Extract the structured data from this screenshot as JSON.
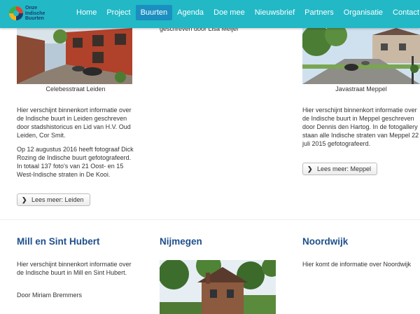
{
  "brand": {
    "logo_lines": [
      "Onze",
      "Indische",
      "Buurten"
    ]
  },
  "nav": {
    "items": [
      {
        "label": "Home",
        "active": false
      },
      {
        "label": "Project",
        "active": false
      },
      {
        "label": "Buurten",
        "active": true
      },
      {
        "label": "Agenda",
        "active": false
      },
      {
        "label": "Doe mee",
        "active": false
      },
      {
        "label": "Nieuwsbrief",
        "active": false
      },
      {
        "label": "Partners",
        "active": false
      },
      {
        "label": "Organisatie",
        "active": false
      },
      {
        "label": "Contact",
        "active": false
      }
    ]
  },
  "leiden": {
    "caption": "Celebesstraat Leiden",
    "para1": "Hier verschijnt binnenkort informatie over de Indische buurt in Leiden geschreven door stadshistoricus en Lid van H.V. Oud Leiden, Cor Smit.",
    "para2": "Op 12 augustus 2016 heeft fotograaf Dick Rozing de Indische buurt gefotografeerd. In totaal 137 foto's van 21 Oost- en 15 West-Indische straten in De Kooi.",
    "button_label": "Lees meer: Leiden"
  },
  "middle": {
    "partial_text": "geschreven door Lisa Meijer"
  },
  "meppel": {
    "caption": "Javastraat Meppel",
    "para1": "Hier verschijnt binnenkort informatie over de Indische buurt in Meppel geschreven door Dennis den Hartog. In de fotogallery staan alle Indische straten van Meppel 22 juli 2015 gefotografeerd.",
    "button_label": "Lees meer: Meppel"
  },
  "mill": {
    "heading": "Mill en Sint Hubert",
    "para1": "Hier verschijnt binnenkort informatie over de Indische buurt in Mill en Sint Hubert.",
    "para2": "Door Miriam Bremmers"
  },
  "nijmegen": {
    "heading": "Nijmegen"
  },
  "noordwijk": {
    "heading": "Noordwijk",
    "para1": "Hier komt de informatie over Noordwijk"
  },
  "colors": {
    "navbar": "#22b8c6",
    "nav_active": "#1a8fc0",
    "heading": "#1e4f8c"
  },
  "icons": {
    "button": "chevron-right-icon"
  }
}
